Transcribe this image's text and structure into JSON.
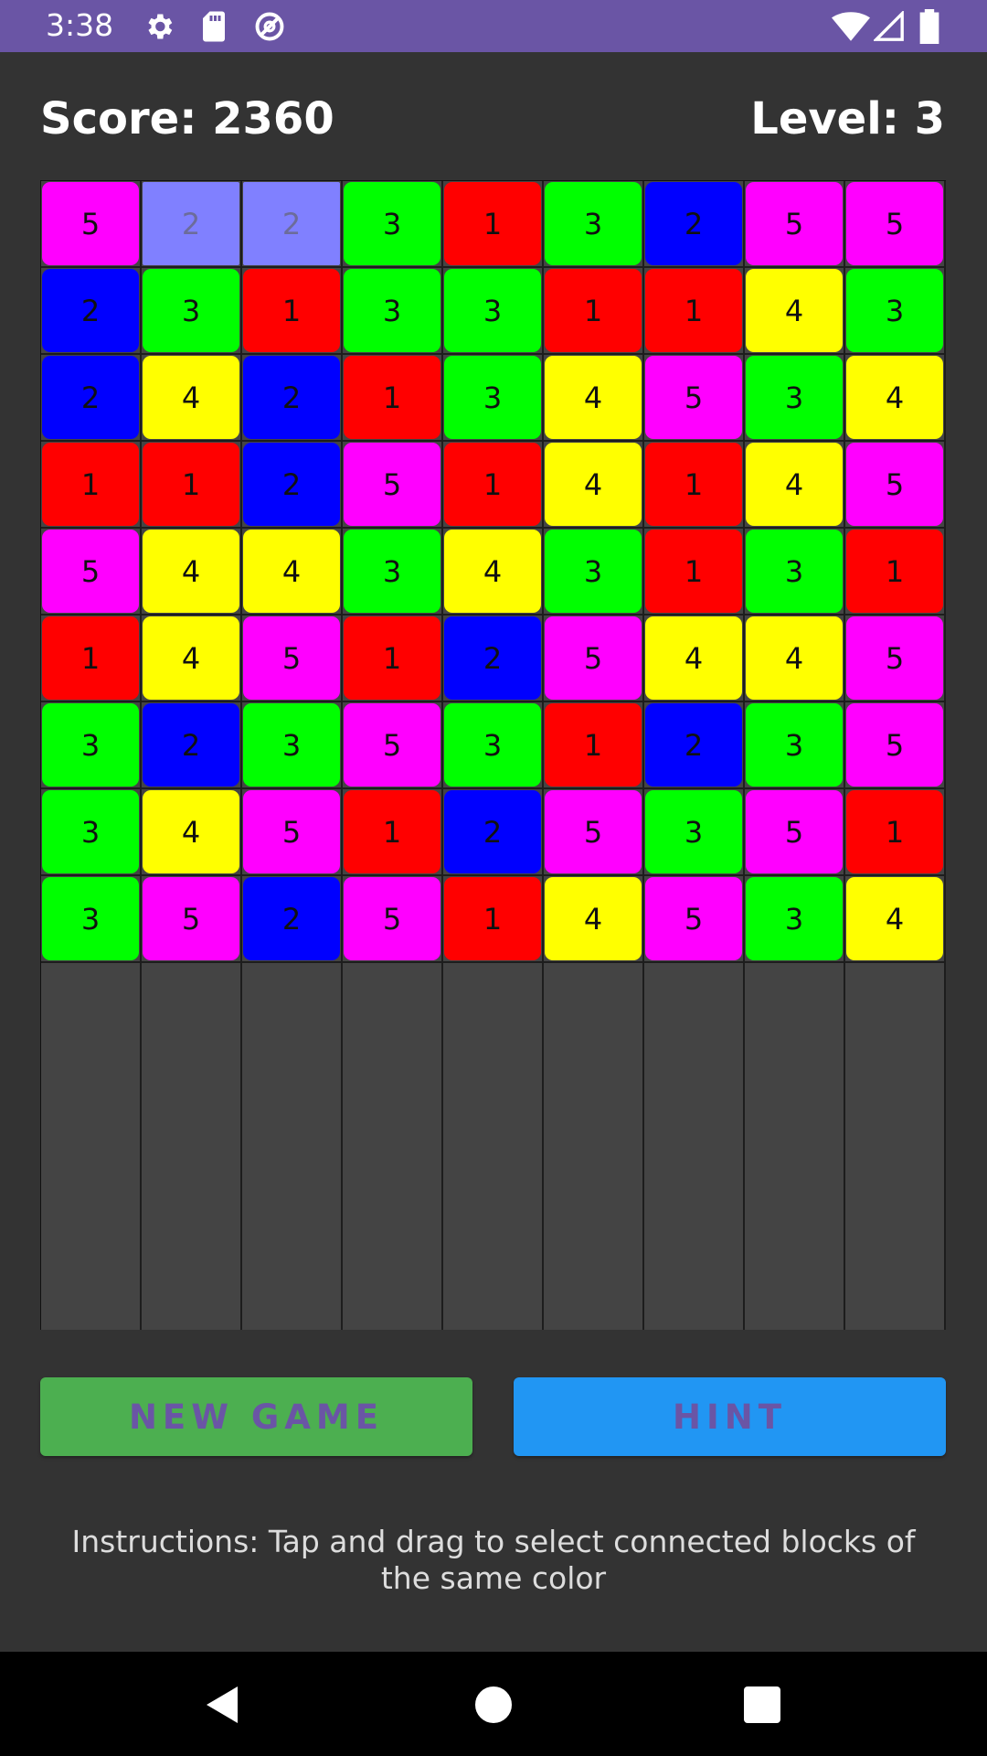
{
  "status_bar": {
    "time": "3:38",
    "left_icons": [
      "settings-icon",
      "sd-card-icon",
      "data-saver-icon"
    ],
    "right_icons": [
      "wifi-icon",
      "signal-icon",
      "battery-icon"
    ],
    "color": "#6a55a5"
  },
  "header": {
    "score_label": "Score: 2360",
    "level_label": "Level: 3"
  },
  "board": {
    "columns": 9,
    "rows": [
      [
        5,
        2,
        2,
        3,
        1,
        3,
        2,
        5,
        5
      ],
      [
        2,
        3,
        1,
        3,
        3,
        1,
        1,
        4,
        3
      ],
      [
        2,
        4,
        2,
        1,
        3,
        4,
        5,
        3,
        4
      ],
      [
        1,
        1,
        2,
        5,
        1,
        4,
        1,
        4,
        5
      ],
      [
        5,
        4,
        4,
        3,
        4,
        3,
        1,
        3,
        1
      ],
      [
        1,
        4,
        5,
        1,
        2,
        5,
        4,
        4,
        5
      ],
      [
        3,
        2,
        3,
        5,
        3,
        1,
        2,
        3,
        5
      ],
      [
        3,
        4,
        5,
        1,
        2,
        5,
        3,
        5,
        1
      ],
      [
        3,
        5,
        2,
        5,
        1,
        4,
        5,
        3,
        4
      ]
    ],
    "selected": [
      [
        0,
        1
      ],
      [
        0,
        2
      ]
    ],
    "colors": {
      "1": "#ff0000",
      "2": "#0000ff",
      "3": "#00ff00",
      "4": "#ffff00",
      "5": "#ff00ff",
      "selected": "#8080ff",
      "empty": "#444444"
    }
  },
  "buttons": {
    "new_game": "NEW GAME",
    "hint": "HINT"
  },
  "instructions": "Instructions: Tap and drag to select connected blocks of the same color",
  "nav_bar": {
    "icons": [
      "back-icon",
      "home-icon",
      "recents-icon"
    ]
  }
}
